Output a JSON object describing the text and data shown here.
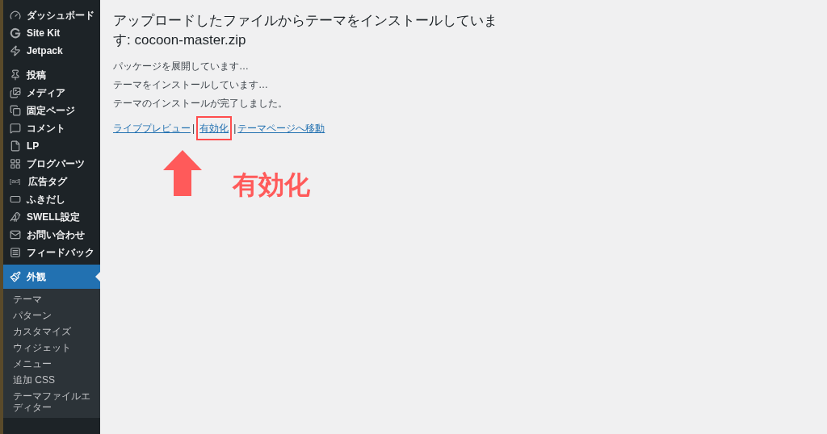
{
  "sidebar": {
    "groups": [
      [
        {
          "label": "ダッシュボード",
          "selected": false
        },
        {
          "label": "Site Kit",
          "selected": false
        },
        {
          "label": "Jetpack",
          "selected": false
        }
      ],
      [
        {
          "label": "投稿",
          "selected": false
        },
        {
          "label": "メディア",
          "selected": false
        },
        {
          "label": "固定ページ",
          "selected": false
        },
        {
          "label": "コメント",
          "selected": false
        },
        {
          "label": "LP",
          "selected": false
        },
        {
          "label": "ブログパーツ",
          "selected": false
        },
        {
          "label": "広告タグ",
          "icon_text": "[ad]",
          "selected": false
        },
        {
          "label": "ふきだし",
          "selected": false
        },
        {
          "label": "SWELL設定",
          "selected": false
        },
        {
          "label": "お問い合わせ",
          "selected": false
        },
        {
          "label": "フィードバック",
          "selected": false
        },
        {
          "label": "外観",
          "selected": true,
          "children": [
            {
              "label": "テーマ",
              "selected": false
            },
            {
              "label": "パターン",
              "selected": false
            },
            {
              "label": "カスタマイズ",
              "selected": false
            },
            {
              "label": "ウィジェット",
              "selected": false
            },
            {
              "label": "メニュー",
              "selected": false
            },
            {
              "label": "追加 CSS",
              "selected": false
            },
            {
              "label": "テーマファイルエディター",
              "selected": false
            }
          ]
        }
      ]
    ]
  },
  "title": "アップロードしたファイルからテーマをインストールしています: cocoon-master.zip",
  "messages": [
    "パッケージを展開しています…",
    "テーマをインストールしています…",
    "テーマのインストールが完了しました。"
  ],
  "links": [
    {
      "label": "ライブプレビュー",
      "highlighted": false
    },
    {
      "label": "有効化",
      "highlighted": true
    },
    {
      "label": "テーマページへ移動",
      "highlighted": false
    }
  ],
  "separator": "|",
  "annotation": {
    "label": "有効化"
  }
}
